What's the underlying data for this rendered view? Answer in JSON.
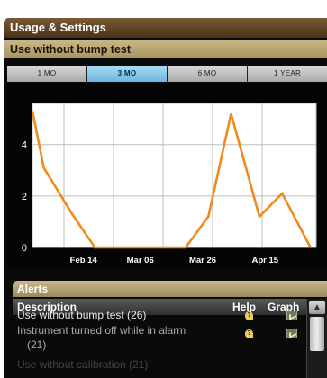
{
  "panel": {
    "title": "Usage & Settings",
    "subtitle": "Use without bump test"
  },
  "tabs": [
    {
      "label": "1 MO",
      "active": false
    },
    {
      "label": "3 MO",
      "active": true
    },
    {
      "label": "6 MO",
      "active": false
    },
    {
      "label": "1 YEAR",
      "active": false
    }
  ],
  "chart_data": {
    "type": "line",
    "title": "",
    "xlabel": "",
    "ylabel": "",
    "x_ticks": [
      "Feb 14",
      "Mar 06",
      "Mar 26",
      "Apr 15"
    ],
    "y_ticks": [
      "0",
      "2",
      "4"
    ],
    "ylim": [
      0,
      5.6
    ],
    "grid": true,
    "color": "#f08a1c",
    "series": [
      {
        "values": [
          [
            0,
            5.3
          ],
          [
            2,
            3.1
          ],
          [
            7,
            1.3
          ],
          [
            11,
            0
          ],
          [
            27,
            0
          ],
          [
            31,
            1.2
          ],
          [
            35,
            5.2
          ],
          [
            40,
            1.2
          ],
          [
            44,
            2.1
          ],
          [
            49,
            0
          ]
        ]
      }
    ],
    "x_range": [
      0,
      50
    ],
    "x_tick_positions": [
      9,
      19,
      30,
      41
    ]
  },
  "alerts": {
    "title": "Alerts",
    "columns": {
      "description": "Description",
      "help": "Help",
      "graph": "Graph"
    },
    "rows": [
      {
        "text": "Use without bump test (26)",
        "help": "?"
      },
      {
        "text": "Instrument turned off while in alarm",
        "text2": "(21)",
        "help": "?"
      },
      {
        "text": "Use without calibration (21)",
        "help": "?"
      }
    ],
    "scroll_up": "▲"
  }
}
